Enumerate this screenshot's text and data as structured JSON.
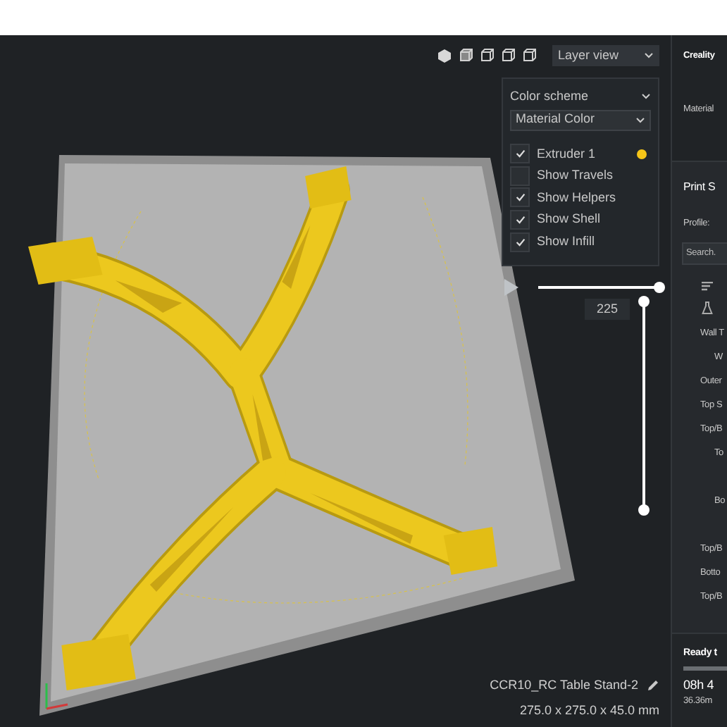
{
  "toolbar": {
    "view_mode": "Layer view"
  },
  "color_panel": {
    "title": "Color scheme",
    "scheme": "Material Color",
    "options": [
      {
        "label": "Extruder 1",
        "checked": true,
        "color": "#f5c518"
      },
      {
        "label": "Show Travels",
        "checked": false
      },
      {
        "label": "Show Helpers",
        "checked": true
      },
      {
        "label": "Show Shell",
        "checked": true
      },
      {
        "label": "Show Infill",
        "checked": true
      }
    ]
  },
  "path_slider": {
    "level": 1
  },
  "layer_slider": {
    "level": 1,
    "layer": "225"
  },
  "object": {
    "name": "CCR10_RC Table Stand-2",
    "dimensions": "275.0 x 275.0 x 45.0 mm"
  },
  "side_panel": {
    "printer": "Creality",
    "material_label": "Material",
    "print_settings_title": "Print S",
    "profile_label": "Profile:",
    "search_placeholder": "Search.",
    "settings": [
      {
        "label": "Wall T",
        "kind": "wide"
      },
      {
        "label": "W",
        "kind": "narrow"
      },
      {
        "label": "Outer",
        "kind": "wide"
      },
      {
        "label": "Top S",
        "kind": "wide"
      },
      {
        "label": "Top/B",
        "kind": "wide"
      },
      {
        "label": "To",
        "kind": "narrow-tall"
      },
      {
        "label": "Bo",
        "kind": "narrow-tall"
      },
      {
        "label": "Top/B",
        "kind": "wide"
      },
      {
        "label": "Botto",
        "kind": "wide"
      },
      {
        "label": "Top/B",
        "kind": "wide"
      }
    ]
  },
  "status": {
    "title": "Ready t",
    "level": 1,
    "time": "08h 4",
    "length": "36.36m"
  }
}
